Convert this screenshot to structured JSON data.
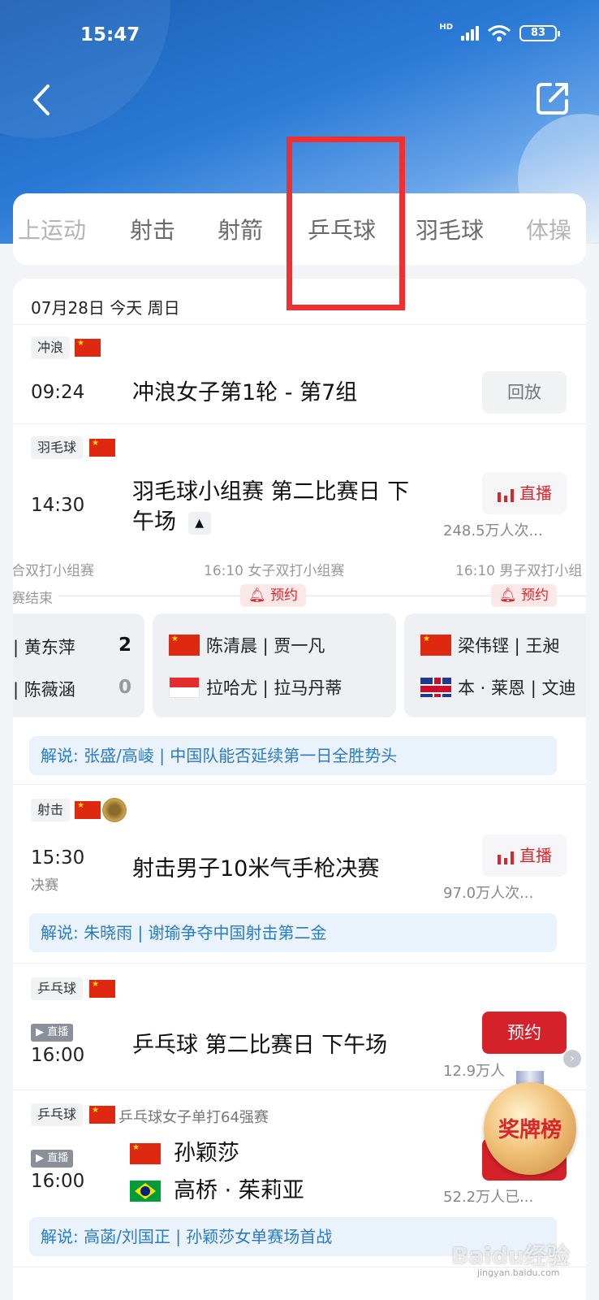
{
  "status_bar": {
    "time": "15:47",
    "network": "HD",
    "battery": "83"
  },
  "tabs": [
    "上运动",
    "射击",
    "射箭",
    "乒乓球",
    "羽毛球",
    "体操"
  ],
  "date_header": "07月28日 今天 周日",
  "events": [
    {
      "sport": "冲浪",
      "time": "09:24",
      "title": "冲浪女子第1轮 - 第7组",
      "action": "回放"
    },
    {
      "sport": "羽毛球",
      "time": "14:30",
      "title_line1": "羽毛球小组赛 第二比赛日 下",
      "title_line2": "午场",
      "action": "直播",
      "viewers": "248.5万人次..."
    },
    {
      "sport": "射击",
      "time": "15:30",
      "stage": "决赛",
      "title": "射击男子10米气手枪决赛",
      "action": "直播",
      "viewers": "97.0万人次...",
      "commentary": "解说: 朱晓雨 | 谢瑜争夺中国射击第二金"
    },
    {
      "sport": "乒乓球",
      "live_badge": "直播",
      "time": "16:00",
      "title": "乒乓球 第二比赛日 下午场",
      "action": "预约",
      "viewers": "12.9万人"
    },
    {
      "sport": "乒乓球",
      "subtitle": "乒乓球女子单打64强赛",
      "live_badge": "直播",
      "time": "16:00",
      "player1": "孙颖莎",
      "player2": "高桥 · 茱莉亚",
      "action": "预约",
      "viewers": "52.2万人已...",
      "commentary": "解说: 高菡/刘国正 | 孙颖莎女单赛场首战"
    }
  ],
  "badminton_matches": {
    "labels": [
      "合双打小组赛",
      "16:10 女子双打小组赛",
      "16:10 男子双打小组"
    ],
    "status_ended": "赛结束",
    "remind_label": "预约",
    "match1": {
      "p1": "| 黄东萍",
      "s1": "2",
      "p2": "| 陈薇涵",
      "s2": "0"
    },
    "match2": {
      "p1": "陈清晨 | 贾一凡",
      "p2": "拉哈尤 | 拉马丹蒂"
    },
    "match3": {
      "p1": "梁伟铿 | 王昶",
      "p2": "本 · 莱恩 | 文迪"
    },
    "commentary": "解说: 张盛/高崚 | 中国队能否延续第一日全胜势头"
  },
  "medal_badge": "奖牌榜",
  "watermark": "Baidu经验",
  "watermark_sub": "jingyan.baidu.com",
  "colors": {
    "accent_red": "#d4212a",
    "link_blue": "#2a7bc0",
    "header_blue": "#1a5fb4",
    "highlight_box": "#ee3030"
  }
}
